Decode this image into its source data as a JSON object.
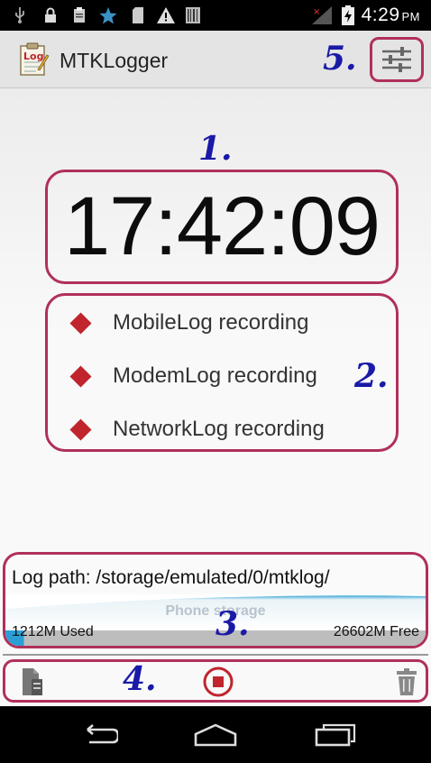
{
  "status_bar": {
    "time": "4:29",
    "ampm": "PM",
    "icons": [
      "usb-icon",
      "lock-icon",
      "clipboard-icon",
      "star-icon",
      "sd-card-icon",
      "warning-icon",
      "barcode-icon",
      "signal-icon",
      "battery-icon"
    ]
  },
  "app_bar": {
    "logo_text": "Log",
    "title": "MTKLogger",
    "settings_icon": "sliders-icon"
  },
  "annotations": {
    "a1": "1.",
    "a2": "2.",
    "a3": "3.",
    "a4": "4.",
    "a5": "5."
  },
  "timer": {
    "value": "17:42:09"
  },
  "log_status": {
    "items": [
      {
        "label": "MobileLog recording"
      },
      {
        "label": "ModemLog recording"
      },
      {
        "label": "NetworkLog recording"
      }
    ],
    "indicator_color": "#c0242d"
  },
  "storage": {
    "log_path": "Log path: /storage/emulated/0/mtklog/",
    "storage_name": "Phone storage",
    "used": "1212M Used",
    "free": "26602M Free",
    "used_fraction": 0.044
  },
  "toolbar": {
    "left_icon": "log-files-icon",
    "center_icon": "stop-record-icon",
    "right_icon": "trash-icon"
  },
  "nav_bar": {
    "back_icon": "back-icon",
    "home_icon": "home-icon",
    "recents_icon": "recents-icon"
  },
  "colors": {
    "accent": "#b0305a",
    "annotation": "#1a1aa8",
    "record_red": "#c0242d"
  }
}
